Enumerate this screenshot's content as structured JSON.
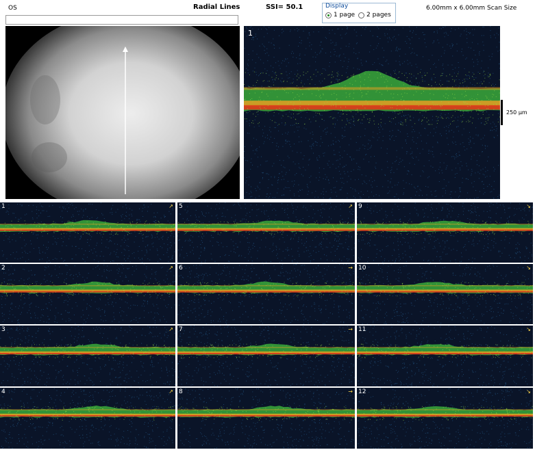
{
  "header": {
    "eye": "OS",
    "scan_mode": "Radial Lines",
    "ssi": "SSI= 50.1",
    "scan_size": "6.00mm x 6.00mm Scan Size",
    "display": {
      "legend": "Display",
      "options": [
        {
          "label": "1 page",
          "selected": true
        },
        {
          "label": "2 pages",
          "selected": false
        }
      ]
    }
  },
  "main_scan": {
    "number": "1",
    "scale_label": "250 µm"
  },
  "thumbnails": [
    {
      "number": "1"
    },
    {
      "number": "5"
    },
    {
      "number": "9"
    },
    {
      "number": "2"
    },
    {
      "number": "6"
    },
    {
      "number": "10"
    },
    {
      "number": "3"
    },
    {
      "number": "7"
    },
    {
      "number": "11"
    },
    {
      "number": "4"
    },
    {
      "number": "8"
    },
    {
      "number": "12"
    }
  ],
  "colors": {
    "noise_background": "#0a1428",
    "retina_green": "#3aa83a",
    "rpe_red": "#e03a1a",
    "rpe_orange": "#f0a020",
    "scan_line": "#ffffff"
  }
}
